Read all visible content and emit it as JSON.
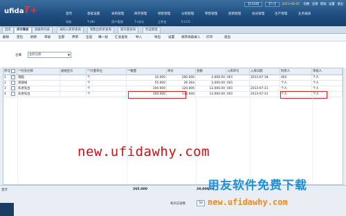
{
  "header": {
    "logo_text": "ufida",
    "logo_mark": "T+",
    "system": [
      "【CS18】",
      "【T+】",
      "2013-08-05"
    ],
    "actions": [
      "切换",
      "注销",
      "帮助",
      "设置",
      "退出"
    ],
    "menu": [
      "首页",
      "基础设置",
      "采购管理",
      "库存管理",
      "销售管理",
      "分销管理",
      "零售管理",
      "促销管理",
      "会员管理",
      "生产管理",
      "业务报表"
    ],
    "submenu": [
      "导航",
      "T-UKI",
      "资产管理",
      "T+办公",
      "工作台",
      "E-CCS"
    ]
  },
  "tabs": [
    "首页",
    "库存看板",
    "调拨单列表",
    "采购入库单查询",
    "销售出库单查询",
    "现存量查询",
    "凭证管理"
  ],
  "active_tab": "库存看板",
  "toolbar": [
    "删除",
    "定位",
    "刷新",
    "审核",
    "全部",
    "弃审",
    "全选",
    "横一视",
    "汇总查询",
    "导入",
    "导出",
    "设置",
    "保存高级录入",
    "打印",
    "退出"
  ],
  "form": {
    "warehouse_label": "仓库",
    "warehouse_value": "主料仓库"
  },
  "grid": {
    "columns": [
      "序号",
      "",
      "*存货名称",
      "规格型号",
      "*计量单位",
      "*数量",
      "单价",
      "金额",
      "入库单号",
      "入库日期",
      "制单人",
      "审核人"
    ],
    "rows": [
      [
        "1",
        "",
        "电脑",
        "",
        "个",
        "10.000",
        "200.000",
        "2,000.00",
        "001",
        "2013-07-18",
        "002",
        "个人"
      ],
      [
        "2",
        "",
        "调速线",
        "",
        "个",
        "55.000",
        "36.364",
        "2,000.00",
        "001",
        "",
        "个人",
        "个人"
      ],
      [
        "3",
        "",
        "先进先出",
        "",
        "个",
        "100.000",
        "120.000",
        "12,000.00",
        "001",
        "2013-07-31",
        "个人",
        "个人"
      ],
      [
        "4",
        "",
        "先进先出",
        "",
        "个",
        "100.000",
        "130.000",
        "13,000.00",
        "001",
        "2013-07-31",
        "个人",
        "个人"
      ]
    ],
    "totals_label": "合计",
    "totals_qty": "265.000",
    "totals_amount": "29,000.00"
  },
  "pager": {
    "label": "每页记录数",
    "value": "50"
  },
  "watermark": {
    "url_red": "new.ufidawhy.com",
    "brand": "用友软件免费下载",
    "url_orange": "new.ufidawhy.com"
  }
}
